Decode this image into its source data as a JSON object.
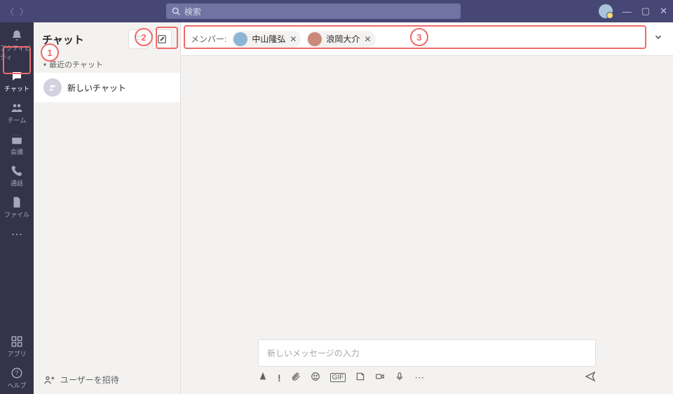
{
  "titlebar": {
    "search_placeholder": "検索"
  },
  "rail": {
    "items": [
      {
        "label": "アクティビティ"
      },
      {
        "label": "チャット"
      },
      {
        "label": "チーム"
      },
      {
        "label": "会議"
      },
      {
        "label": "通話"
      },
      {
        "label": "ファイル"
      }
    ],
    "apps_label": "アプリ",
    "help_label": "ヘルプ"
  },
  "listpane": {
    "title": "チャット",
    "section_label": "最近のチャット",
    "new_chat_label": "新しいチャット",
    "invite_label": "ユーザーを招待"
  },
  "members": {
    "label": "メンバー:",
    "chips": [
      {
        "name": "中山隆弘"
      },
      {
        "name": "浪岡大介"
      }
    ]
  },
  "compose": {
    "placeholder": "新しいメッセージの入力"
  },
  "annotations": {
    "one": "1",
    "two": "2",
    "three": "3"
  }
}
